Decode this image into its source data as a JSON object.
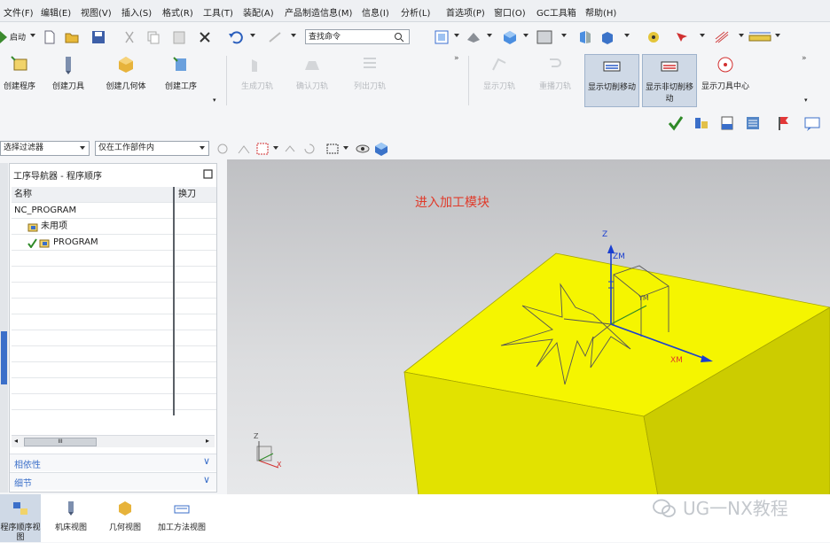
{
  "menu": [
    "文件(F)",
    "编辑(E)",
    "视图(V)",
    "插入(S)",
    "格式(R)",
    "工具(T)",
    "装配(A)",
    "产品制造信息(M)",
    "信息(I)",
    "分析(L)",
    "首选项(P)",
    "窗口(O)",
    "GC工具箱",
    "帮助(H)"
  ],
  "quickbar": {
    "start_label": "启动",
    "search_placeholder": "查找命令"
  },
  "ribbon": {
    "create_program": "创建程序",
    "create_tool": "创建刀具",
    "create_geometry": "创建几何体",
    "create_operation": "创建工序",
    "generate_toolpath": "生成刀轨",
    "confirm_toolpath": "确认刀轨",
    "list_toolpath": "列出刀轨",
    "show_toolpath": "显示刀轨",
    "replay_toolpath": "重播刀轨",
    "show_cut_moves": "显示切削移动",
    "show_noncut_moves": "显示非切削移动",
    "show_tool_center": "显示刀具中心"
  },
  "filterbar": {
    "selection_filter": "选择过滤器",
    "scope": "仅在工作部件内"
  },
  "navigator": {
    "title": "工序导航器 - 程序顺序",
    "columns": [
      "名称",
      "换刀"
    ],
    "rows": [
      {
        "name": "NC_PROGRAM",
        "indent": 0
      },
      {
        "name": "未用项",
        "indent": 1
      },
      {
        "name": "PROGRAM",
        "indent": 1
      }
    ],
    "scroll_grip": "III",
    "section_dependencies": "相依性",
    "section_details": "细节"
  },
  "bottom_tabs": [
    "程序顺序视图",
    "机床视图",
    "几何视图",
    "加工方法视图"
  ],
  "viewport": {
    "annotation": "进入加工模块",
    "axis_labels": {
      "z": "Z",
      "zm": "ZM",
      "xm": "XM",
      "ym": "YM",
      "mini_z": "Z",
      "mini_x": "X"
    },
    "watermark": "UG一NX教程"
  },
  "colors": {
    "part_top": "#f5f500",
    "part_side_left": "#e2e200",
    "part_side_right": "#cccc00",
    "annotation": "#e03a2a",
    "axis_blue": "#1a3fd0"
  }
}
